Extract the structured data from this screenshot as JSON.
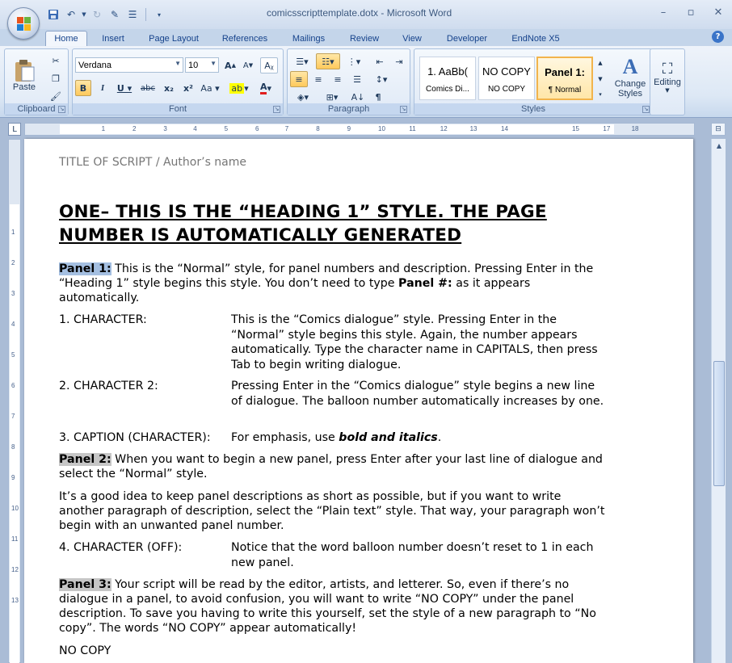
{
  "window": {
    "title": "comicsscripttemplate.dotx - Microsoft Word"
  },
  "ribbon_tabs": [
    "Home",
    "Insert",
    "Page Layout",
    "References",
    "Mailings",
    "Review",
    "View",
    "Developer",
    "EndNote X5"
  ],
  "clipboard": {
    "paste_label": "Paste",
    "group_label": "Clipboard"
  },
  "font": {
    "name": "Verdana",
    "size": "10",
    "group_label": "Font"
  },
  "paragraph": {
    "group_label": "Paragraph"
  },
  "styles": {
    "group_label": "Styles",
    "items": [
      {
        "sample": "1.  AaBb(",
        "name": "Comics Di..."
      },
      {
        "sample": "NO COPY",
        "name": "NO COPY"
      },
      {
        "sample": "Panel 1:",
        "name": "¶ Normal"
      }
    ],
    "change_styles_label": "Change Styles"
  },
  "editing": {
    "label": "Editing"
  },
  "ruler": {
    "h_numbers": [
      "1",
      "2",
      "3",
      "4",
      "5",
      "6",
      "7",
      "8",
      "9",
      "10",
      "11",
      "12",
      "13",
      "14",
      "15",
      "17",
      "18"
    ],
    "v_numbers": [
      "1",
      "2",
      "3",
      "4",
      "5",
      "6",
      "7",
      "8",
      "9",
      "10",
      "11",
      "12",
      "13"
    ]
  },
  "document": {
    "header": "TITLE OF SCRIPT / Author’s name",
    "heading": "ONE– THIS IS THE “HEADING 1” STYLE. THE PAGE NUMBER IS AUTOMATICALLY GENERATED",
    "p1_label": "Panel 1:",
    "p1_text_a": " This is the “Normal” style, for panel numbers and description. Pressing Enter in the “Heading 1” style begins this style. You don’t need to type ",
    "p1_bold": "Panel #:",
    "p1_text_b": " as it appears automatically.",
    "d1_who": "1. CHARACTER:",
    "d1_say": "This is the “Comics dialogue” style. Pressing Enter in the “Normal” style begins this style. Again, the number appears automatically. Type the character name in CAPITALS, then press Tab to begin writing dialogue.",
    "d2_who": "2. CHARACTER 2:",
    "d2_say": "Pressing Enter in the “Comics dialogue” style begins a new line of dialogue. The balloon number automatically increases by one.",
    "d3_who": "3. CAPTION (CHARACTER):",
    "d3_say_a": "For emphasis, use ",
    "d3_say_bi": "bold and italics",
    "d3_say_b": ".",
    "p2_label": "Panel 2:",
    "p2_text": " When you want to begin a new panel, press Enter after your last line of dialogue and select the “Normal” style.",
    "p2b_text": "It’s a good idea to keep panel descriptions as short as possible, but if you want to write another paragraph of description, select the “Plain text” style. That way, your paragraph won’t begin with an unwanted panel number.",
    "d4_who": "4. CHARACTER (OFF):",
    "d4_say": "Notice that the word balloon number doesn’t reset to 1 in each new panel.",
    "p3_label": "Panel 3:",
    "p3_text": " Your script will be read by the editor, artists, and letterer. So, even if there’s no dialogue in a panel, to avoid confusion, you will want to write “NO COPY” under the panel description. To save you having to write this yourself, set the style of a new paragraph to “No copy”. The words “NO COPY” appear automatically!",
    "nocopy": "NO COPY"
  }
}
